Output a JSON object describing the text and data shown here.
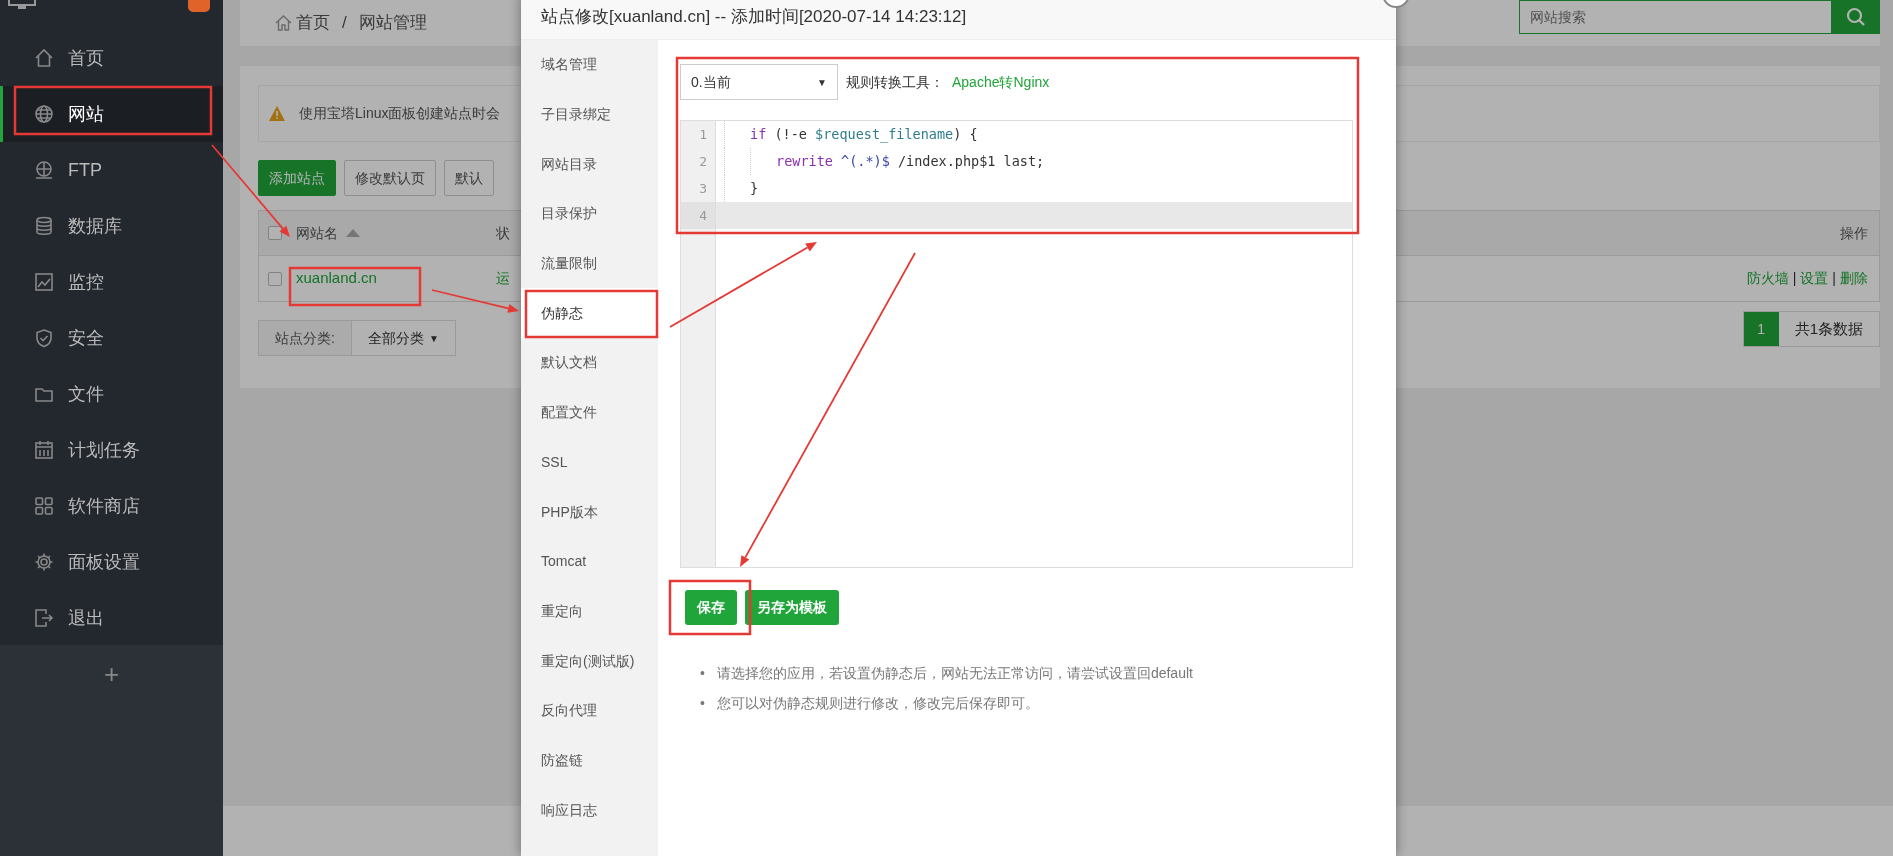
{
  "sidebar": {
    "items": [
      {
        "label": "首页",
        "selected": false
      },
      {
        "label": "网站",
        "selected": true
      },
      {
        "label": "FTP",
        "selected": false
      },
      {
        "label": "数据库",
        "selected": false
      },
      {
        "label": "监控",
        "selected": false
      },
      {
        "label": "安全",
        "selected": false
      },
      {
        "label": "文件",
        "selected": false
      },
      {
        "label": "计划任务",
        "selected": false
      },
      {
        "label": "软件商店",
        "selected": false
      },
      {
        "label": "面板设置",
        "selected": false
      },
      {
        "label": "退出",
        "selected": false
      }
    ],
    "add_label": "+"
  },
  "breadcrumb": {
    "items": [
      "首页",
      "网站管理"
    ],
    "separator": "/"
  },
  "search": {
    "placeholder": "网站搜索"
  },
  "alert": "使用宝塔Linux面板创建站点时会",
  "toolbar_buttons": [
    {
      "label": "添加站点",
      "kind": "primary"
    },
    {
      "label": "修改默认页",
      "kind": "default"
    },
    {
      "label": "默认",
      "kind": "default"
    }
  ],
  "table": {
    "select_all_checked": false,
    "columns": [
      "网站名",
      "状",
      "操作"
    ],
    "rows": [
      {
        "checked": false,
        "name": "xuanland.cn",
        "status": "运",
        "actions": [
          "防火墙",
          "设置",
          "删除"
        ],
        "separator": "|"
      }
    ]
  },
  "category": {
    "label": "站点分类:",
    "value": "全部分类",
    "caret": "▼"
  },
  "pagination": {
    "pages": [
      {
        "label": "1",
        "selected": true
      }
    ],
    "summary": "共1条数据"
  },
  "modal": {
    "title": "站点修改[xuanland.cn] -- 添加时间[2020-07-14 14:23:12]",
    "tabs": [
      {
        "label": "域名管理",
        "selected": false
      },
      {
        "label": "子目录绑定",
        "selected": false
      },
      {
        "label": "网站目录",
        "selected": false
      },
      {
        "label": "目录保护",
        "selected": false
      },
      {
        "label": "流量限制",
        "selected": false
      },
      {
        "label": "伪静态",
        "selected": true
      },
      {
        "label": "默认文档",
        "selected": false
      },
      {
        "label": "配置文件",
        "selected": false
      },
      {
        "label": "SSL",
        "selected": false
      },
      {
        "label": "PHP版本",
        "selected": false
      },
      {
        "label": "Tomcat",
        "selected": false
      },
      {
        "label": "重定向",
        "selected": false
      },
      {
        "label": "重定向(测试版)",
        "selected": false
      },
      {
        "label": "反向代理",
        "selected": false
      },
      {
        "label": "防盗链",
        "selected": false
      },
      {
        "label": "响应日志",
        "selected": false
      }
    ],
    "rewrite_select": "0.当前",
    "rewrite_caret": "▼",
    "converter_label": "规则转换工具：",
    "converter_link": "Apache转Nginx",
    "code_lines": [
      {
        "number": "1",
        "selected": false,
        "tokens": [
          {
            "kind": "keyword",
            "text": "if"
          },
          {
            "kind": "plain",
            "text": " (!-e "
          },
          {
            "kind": "variable",
            "text": "$request_filename"
          },
          {
            "kind": "plain",
            "text": ") {"
          }
        ],
        "children": [
          {
            "number": "2",
            "selected": false,
            "tokens": [
              {
                "kind": "keyword",
                "text": "rewrite "
              },
              {
                "kind": "regex",
                "text": "^(.*)$"
              },
              {
                "kind": "plain",
                "text": " /index.php$1 last;"
              }
            ]
          }
        ]
      },
      {
        "number": "3",
        "selected": false,
        "tokens": [
          {
            "kind": "plain",
            "text": "}"
          }
        ]
      },
      {
        "number": "4",
        "selected": true
      }
    ],
    "buttons": [
      "保存",
      "另存为模板"
    ],
    "tips": [
      {
        "marker": "•",
        "text": "请选择您的应用，若设置伪静态后，网站无法正常访问，请尝试设置回default"
      },
      {
        "marker": "•",
        "text": "您可以对伪静态规则进行修改，修改完后保存即可。"
      }
    ]
  }
}
